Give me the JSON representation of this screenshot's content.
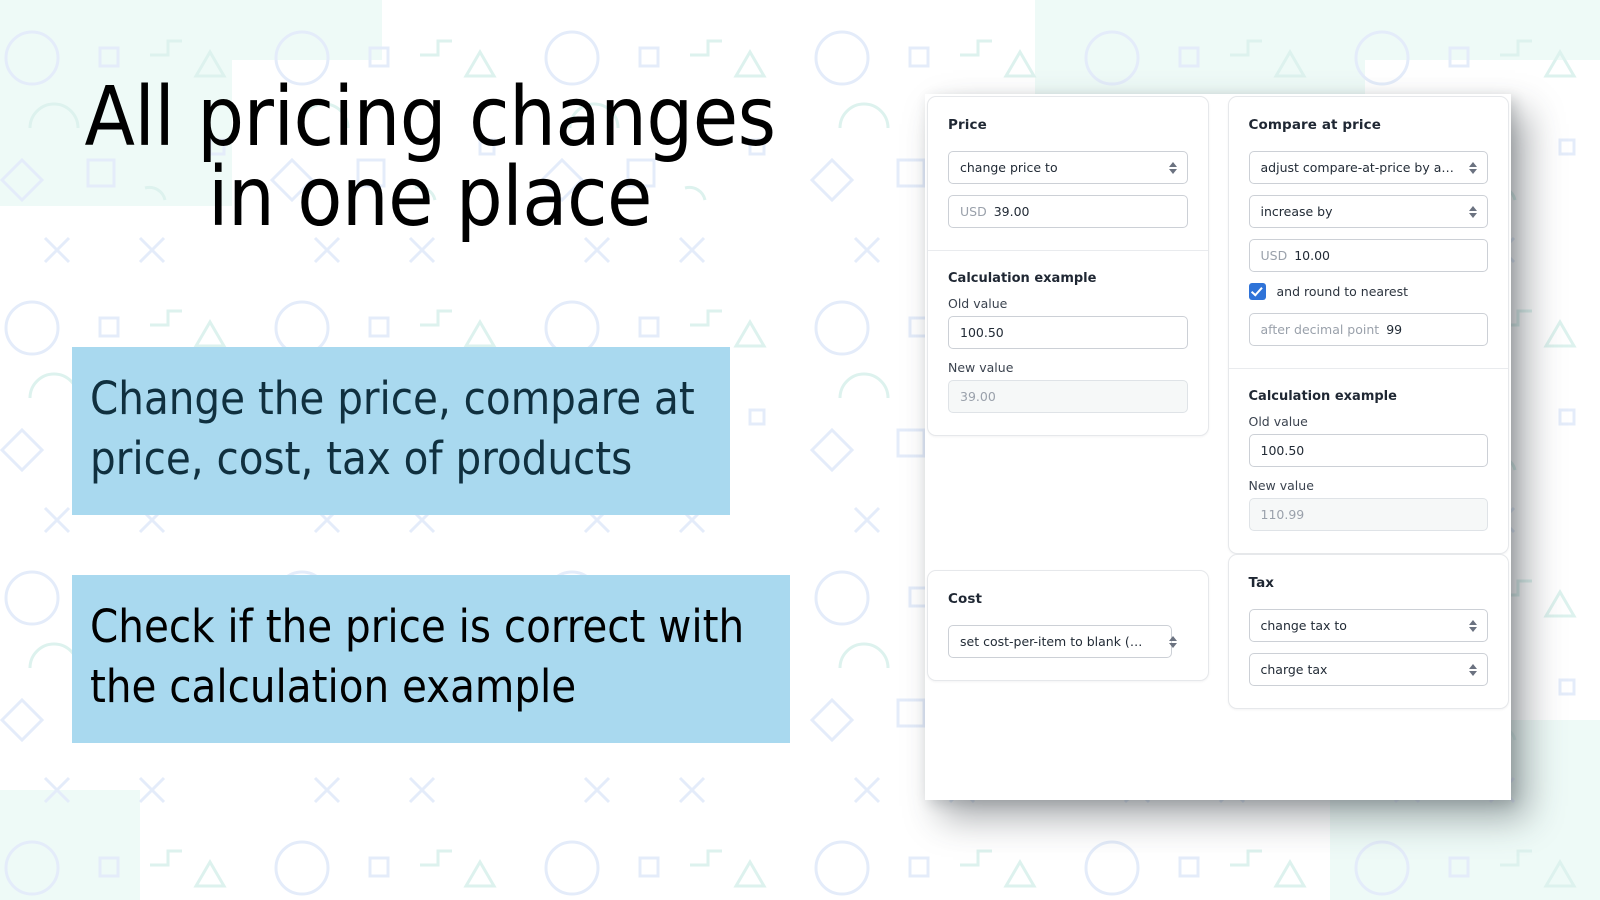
{
  "hero": {
    "headline": "All pricing changes\nin one place",
    "highlights": [
      {
        "text": "Change the price, compare at\nprice, cost, tax of products",
        "background": "#a9d9ef",
        "color": "#10303f"
      },
      {
        "text": "Check if the price is correct with\nthe calculation example",
        "background": "#a9d9ef",
        "color": "#000000"
      }
    ]
  },
  "theme": {
    "accent_checkbox": "#2f73d8",
    "highlight": "#a9d9ef",
    "mint_panel": "#eefaf7",
    "pattern_blue": "#e4ecfa",
    "pattern_mint": "#ddf2ee",
    "card_border": "#e6e8eb",
    "input_border": "#ccd0d6"
  },
  "app": {
    "price_card": {
      "title": "Price",
      "action_select": {
        "value": "change price to",
        "options": [
          "change price to"
        ]
      },
      "amount_field": {
        "prefix": "USD",
        "value": "39.00"
      },
      "calculation": {
        "title": "Calculation example",
        "old_label": "Old value",
        "old_value": "100.50",
        "new_label": "New value",
        "new_value": "39.00"
      }
    },
    "compare_card": {
      "title": "Compare at price",
      "action_select": {
        "value": "adjust compare-at-price by a…",
        "options": [
          "adjust compare-at-price by a…"
        ]
      },
      "direction_select": {
        "value": "increase by",
        "options": [
          "increase by"
        ]
      },
      "amount_field": {
        "prefix": "USD",
        "value": "10.00"
      },
      "round_checkbox": {
        "label": "and round to nearest",
        "checked": true
      },
      "round_field": {
        "prefix": "after decimal point",
        "value": "99"
      },
      "calculation": {
        "title": "Calculation example",
        "old_label": "Old value",
        "old_value": "100.50",
        "new_label": "New value",
        "new_value": "110.99"
      }
    },
    "cost_card": {
      "title": "Cost",
      "action_select": {
        "value": "set cost-per-item to blank (NU…",
        "options": [
          "set cost-per-item to blank (NU…"
        ]
      }
    },
    "tax_card": {
      "title": "Tax",
      "action_select": {
        "value": "change tax to",
        "options": [
          "change tax to"
        ]
      },
      "charge_select": {
        "value": "charge tax",
        "options": [
          "charge tax"
        ]
      }
    }
  }
}
